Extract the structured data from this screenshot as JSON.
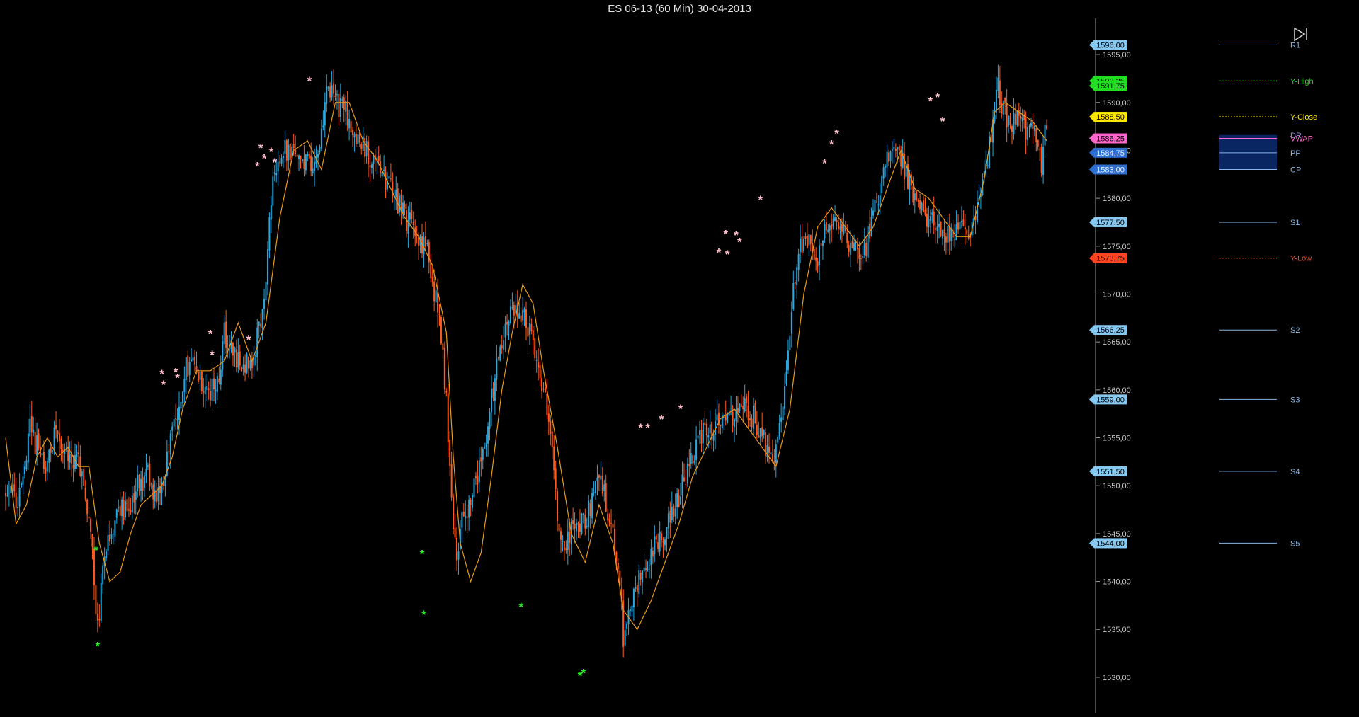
{
  "window": {
    "title": "ES 06-13 (60 Min)  30-04-2013"
  },
  "colors": {
    "background": "#000000",
    "up_candle": "#29a8e0",
    "down_candle": "#ff5a1f",
    "moving_average": "#e89a1c",
    "high_star": "#ffc0cb",
    "low_star": "#22ee22",
    "pivot_line": "#86b7e6",
    "y_high": "#22dd22",
    "y_close": "#ffe800",
    "y_low": "#ff4422",
    "vwap": "#ff66cc",
    "value_zone": "#0a2a6e"
  },
  "icons": {
    "playback": "skip-to-end-icon"
  },
  "chart_data": {
    "type": "candlestick",
    "instrument": "ES 06-13",
    "timeframe": "60 Min",
    "date": "30-04-2013",
    "ylim": [
      1528,
      1597
    ],
    "y_ticks": [
      "1530,00",
      "1535,00",
      "1540,00",
      "1545,00",
      "1550,00",
      "1555,00",
      "1560,00",
      "1565,00",
      "1570,00",
      "1575,00",
      "1580,00",
      "1585,00",
      "1590,00",
      "1595,00"
    ],
    "anchors": [
      [
        0,
        1549
      ],
      [
        8,
        1548.5
      ],
      [
        14,
        1556
      ],
      [
        18,
        1554
      ],
      [
        24,
        1552
      ],
      [
        28,
        1555
      ],
      [
        34,
        1553
      ],
      [
        40,
        1553
      ],
      [
        44,
        1551
      ],
      [
        47,
        1548
      ],
      [
        50,
        1543
      ],
      [
        53,
        1535
      ],
      [
        56,
        1541
      ],
      [
        60,
        1545
      ],
      [
        65,
        1548
      ],
      [
        70,
        1547
      ],
      [
        76,
        1550
      ],
      [
        82,
        1551
      ],
      [
        87,
        1548
      ],
      [
        92,
        1552
      ],
      [
        98,
        1557
      ],
      [
        103,
        1562
      ],
      [
        108,
        1563
      ],
      [
        113,
        1561
      ],
      [
        118,
        1560
      ],
      [
        123,
        1562
      ],
      [
        126,
        1566
      ],
      [
        130,
        1564
      ],
      [
        136,
        1563
      ],
      [
        142,
        1563
      ],
      [
        146,
        1566
      ],
      [
        150,
        1572
      ],
      [
        154,
        1582
      ],
      [
        158,
        1585
      ],
      [
        164,
        1585
      ],
      [
        170,
        1583
      ],
      [
        176,
        1584
      ],
      [
        182,
        1586
      ],
      [
        186,
        1592
      ],
      [
        190,
        1590
      ],
      [
        196,
        1589
      ],
      [
        202,
        1586
      ],
      [
        208,
        1585
      ],
      [
        215,
        1583
      ],
      [
        222,
        1581
      ],
      [
        230,
        1578
      ],
      [
        238,
        1576
      ],
      [
        244,
        1574
      ],
      [
        250,
        1567
      ],
      [
        254,
        1559
      ],
      [
        257,
        1548
      ],
      [
        260,
        1543
      ],
      [
        263,
        1546
      ],
      [
        268,
        1549
      ],
      [
        275,
        1553
      ],
      [
        281,
        1560
      ],
      [
        286,
        1565
      ],
      [
        290,
        1568
      ],
      [
        294,
        1569
      ],
      [
        298,
        1568
      ],
      [
        303,
        1566
      ],
      [
        308,
        1562
      ],
      [
        314,
        1556
      ],
      [
        318,
        1547
      ],
      [
        322,
        1542
      ],
      [
        326,
        1546
      ],
      [
        332,
        1546
      ],
      [
        338,
        1548
      ],
      [
        342,
        1552
      ],
      [
        346,
        1548
      ],
      [
        350,
        1545
      ],
      [
        354,
        1540
      ],
      [
        356,
        1534
      ],
      [
        360,
        1537
      ],
      [
        366,
        1541
      ],
      [
        372,
        1543
      ],
      [
        378,
        1545
      ],
      [
        384,
        1547
      ],
      [
        390,
        1550
      ],
      [
        396,
        1553
      ],
      [
        402,
        1556
      ],
      [
        408,
        1556
      ],
      [
        414,
        1557
      ],
      [
        420,
        1557
      ],
      [
        426,
        1558
      ],
      [
        432,
        1557
      ],
      [
        438,
        1554
      ],
      [
        444,
        1553
      ],
      [
        450,
        1562
      ],
      [
        454,
        1570
      ],
      [
        458,
        1575
      ],
      [
        462,
        1576
      ],
      [
        468,
        1574
      ],
      [
        476,
        1578
      ],
      [
        482,
        1577
      ],
      [
        488,
        1575
      ],
      [
        494,
        1574
      ],
      [
        500,
        1578
      ],
      [
        506,
        1583
      ],
      [
        512,
        1586
      ],
      [
        518,
        1583
      ],
      [
        524,
        1580
      ],
      [
        530,
        1578
      ],
      [
        536,
        1577
      ],
      [
        542,
        1576
      ],
      [
        548,
        1577
      ],
      [
        554,
        1576
      ],
      [
        560,
        1579
      ],
      [
        566,
        1584
      ],
      [
        570,
        1590
      ],
      [
        572,
        1592
      ],
      [
        574,
        1590
      ],
      [
        578,
        1588
      ],
      [
        584,
        1588
      ],
      [
        590,
        1587
      ],
      [
        594,
        1586
      ],
      [
        597,
        1583
      ],
      [
        600,
        1588.5
      ]
    ],
    "ma_anchors": [
      [
        0,
        1555
      ],
      [
        6,
        1546
      ],
      [
        12,
        1548
      ],
      [
        18,
        1553
      ],
      [
        24,
        1555
      ],
      [
        30,
        1553
      ],
      [
        36,
        1554
      ],
      [
        42,
        1552
      ],
      [
        48,
        1552
      ],
      [
        54,
        1544
      ],
      [
        60,
        1540
      ],
      [
        66,
        1541
      ],
      [
        72,
        1545
      ],
      [
        78,
        1548
      ],
      [
        84,
        1549
      ],
      [
        90,
        1550
      ],
      [
        96,
        1553
      ],
      [
        102,
        1558
      ],
      [
        110,
        1562
      ],
      [
        118,
        1562
      ],
      [
        126,
        1563
      ],
      [
        134,
        1567
      ],
      [
        142,
        1563
      ],
      [
        150,
        1567
      ],
      [
        158,
        1578
      ],
      [
        166,
        1585
      ],
      [
        174,
        1586
      ],
      [
        182,
        1583
      ],
      [
        190,
        1590
      ],
      [
        198,
        1590
      ],
      [
        206,
        1586
      ],
      [
        214,
        1584
      ],
      [
        222,
        1581
      ],
      [
        230,
        1578
      ],
      [
        238,
        1576
      ],
      [
        246,
        1573
      ],
      [
        254,
        1566
      ],
      [
        258,
        1553
      ],
      [
        262,
        1544
      ],
      [
        268,
        1540
      ],
      [
        274,
        1543
      ],
      [
        280,
        1551
      ],
      [
        286,
        1560
      ],
      [
        292,
        1566
      ],
      [
        298,
        1571
      ],
      [
        304,
        1569
      ],
      [
        310,
        1562
      ],
      [
        318,
        1554
      ],
      [
        326,
        1545
      ],
      [
        334,
        1542
      ],
      [
        342,
        1548
      ],
      [
        350,
        1544
      ],
      [
        356,
        1537
      ],
      [
        364,
        1535
      ],
      [
        372,
        1538
      ],
      [
        380,
        1542
      ],
      [
        388,
        1546
      ],
      [
        396,
        1551
      ],
      [
        404,
        1554
      ],
      [
        412,
        1557
      ],
      [
        420,
        1558
      ],
      [
        428,
        1556
      ],
      [
        436,
        1554
      ],
      [
        444,
        1552
      ],
      [
        452,
        1558
      ],
      [
        460,
        1570
      ],
      [
        468,
        1577
      ],
      [
        476,
        1579
      ],
      [
        484,
        1577
      ],
      [
        492,
        1575
      ],
      [
        500,
        1577
      ],
      [
        508,
        1581
      ],
      [
        516,
        1585
      ],
      [
        524,
        1581
      ],
      [
        532,
        1580
      ],
      [
        540,
        1578
      ],
      [
        548,
        1576
      ],
      [
        556,
        1576
      ],
      [
        564,
        1582
      ],
      [
        570,
        1589
      ],
      [
        576,
        1590
      ],
      [
        584,
        1589
      ],
      [
        592,
        1588
      ],
      [
        600,
        1586
      ]
    ],
    "highlight_asterisks": [
      [
        52,
        1543.2
      ],
      [
        53,
        1533.2
      ],
      [
        240,
        1542.8
      ],
      [
        241,
        1536.5
      ],
      [
        297,
        1537.3
      ],
      [
        331,
        1530.1
      ],
      [
        333,
        1530.4
      ]
    ],
    "swing_asterisks": [
      [
        90,
        1561.6
      ],
      [
        91,
        1560.5
      ],
      [
        98,
        1561.8
      ],
      [
        99,
        1561.2
      ],
      [
        118,
        1565.8
      ],
      [
        119,
        1563.6
      ],
      [
        140,
        1565.2
      ],
      [
        145,
        1583.3
      ],
      [
        147,
        1585.2
      ],
      [
        149,
        1584.1
      ],
      [
        153,
        1584.8
      ],
      [
        155,
        1583.7
      ],
      [
        175,
        1592.2
      ],
      [
        366,
        1556.0
      ],
      [
        370,
        1556.0
      ],
      [
        378,
        1556.9
      ],
      [
        389,
        1558.0
      ],
      [
        411,
        1574.3
      ],
      [
        415,
        1576.2
      ],
      [
        416,
        1574.1
      ],
      [
        421,
        1576.1
      ],
      [
        423,
        1575.4
      ],
      [
        435,
        1579.8
      ],
      [
        472,
        1583.6
      ],
      [
        476,
        1585.6
      ],
      [
        479,
        1586.7
      ],
      [
        533,
        1590.1
      ],
      [
        537,
        1590.5
      ],
      [
        540,
        1588.0
      ]
    ],
    "levels": [
      {
        "label": "R1",
        "value": 1596.0,
        "price": "1596,00",
        "style": "solid",
        "color": "#86b7e6",
        "badge": "#86c8f0"
      },
      {
        "label": "Y-High",
        "value": 1592.25,
        "price": "1592,25",
        "style": "dotted",
        "color": "#22dd22",
        "badge": "#22dd22"
      },
      {
        "label": "Y-Close",
        "value": 1588.5,
        "price": "1588,50",
        "style": "dotted",
        "color": "#ffe800",
        "badge": "#ffe800"
      },
      {
        "label": "VWAP",
        "value": 1586.25,
        "price": "1586,25",
        "style": "solid",
        "color": "#ff66cc",
        "badge": "#ff66cc"
      },
      {
        "label": "PP",
        "value": 1584.75,
        "price": "1584,75",
        "style": "solid",
        "color": "#86b7e6",
        "badge": "#2f6fd0"
      },
      {
        "label": "CP",
        "value": 1583.0,
        "price": "1583,00",
        "style": "solid",
        "color": "#86b7e6",
        "badge": "#2f6fd0"
      },
      {
        "label": "S1",
        "value": 1577.5,
        "price": "1577,50",
        "style": "solid",
        "color": "#86b7e6",
        "badge": "#86c8f0"
      },
      {
        "label": "Y-Low",
        "value": 1573.75,
        "price": "1573,75",
        "style": "dotted",
        "color": "#ff4422",
        "badge": "#ff4422"
      },
      {
        "label": "S2",
        "value": 1566.25,
        "price": "1566,25",
        "style": "solid",
        "color": "#86b7e6",
        "badge": "#86c8f0"
      },
      {
        "label": "S3",
        "value": 1559.0,
        "price": "1559,00",
        "style": "solid",
        "color": "#86b7e6",
        "badge": "#86c8f0"
      },
      {
        "label": "S4",
        "value": 1551.5,
        "price": "1551,50",
        "style": "solid",
        "color": "#86b7e6",
        "badge": "#86c8f0"
      },
      {
        "label": "S5",
        "value": 1544.0,
        "price": "1544,00",
        "style": "solid",
        "color": "#86b7e6",
        "badge": "#86c8f0"
      }
    ],
    "current_price": {
      "value": 1591.75,
      "price": "1591,75",
      "color": "#22dd22"
    },
    "zone_label": {
      "label": "DR",
      "value": 1586.6
    },
    "value_zone": {
      "from": 1583.0,
      "to": 1586.6
    }
  }
}
